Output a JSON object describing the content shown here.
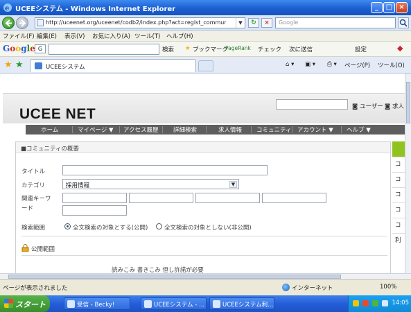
{
  "window": {
    "title": "UCEEシステム - Windows Internet Explorer",
    "minimize_label": "_",
    "maximize_label": "□",
    "close_label": "×"
  },
  "address_bar": {
    "url": "http://uceenet.org/uceenet/codb2/index.php?act=regist_community&mode",
    "search_placeholder": "Google"
  },
  "menu": {
    "items": [
      "ファイル(F)",
      "編集(E)",
      "表示(V)",
      "お気に入り(A)",
      "ツール(T)",
      "ヘルプ(H)"
    ]
  },
  "google_toolbar": {
    "logo": "Google",
    "g_label": "G",
    "search_label": "検索",
    "bookmark_label": "ブックマーク",
    "pagerank_label": "PageRank",
    "check_label": "チェック",
    "send_label": "次に送信",
    "settings_label": "設定"
  },
  "tabs": {
    "active_label": "UCEEシステム",
    "page_label": "ページ(P)",
    "tools_label": "ツール(O)"
  },
  "site": {
    "logo": "UCEE NET",
    "user_label": "ユーザー",
    "member_label": "求人",
    "nav": [
      "ホーム",
      "マイページ ▼",
      "アクセス履歴",
      "詳細検索",
      "求人情報",
      "コミュニティ",
      "アカウント ▼",
      "ヘルプ ▼"
    ]
  },
  "form": {
    "panel_title": "■コミュニティの概要",
    "title_label": "タイトル",
    "category_label": "カテゴリ",
    "category_value": "採用情報",
    "keywords_label_line1": "関連キーワ",
    "keywords_label_line2": "ード",
    "scope_label": "検索範囲",
    "scope_option_1": "全文検索の対象とする(公開)",
    "scope_option_2": "全文検索の対象としない(非公開)",
    "public_scope_label": "公開範囲",
    "access_text": "読みこみ 書きこみ 但し許諾が必要"
  },
  "right_sidebar": {
    "items": [
      "コ",
      "コ",
      "コ",
      "コ",
      "コ",
      "利"
    ]
  },
  "status_bar": {
    "message": "ページが表示されました",
    "zone": "インターネット",
    "zoom": "100%"
  },
  "taskbar": {
    "start_label": "スタート",
    "items": [
      "受信 - Becky!",
      "UCEEシステム - ...",
      "UCEEシステム利..."
    ],
    "clock": "14:05"
  }
}
